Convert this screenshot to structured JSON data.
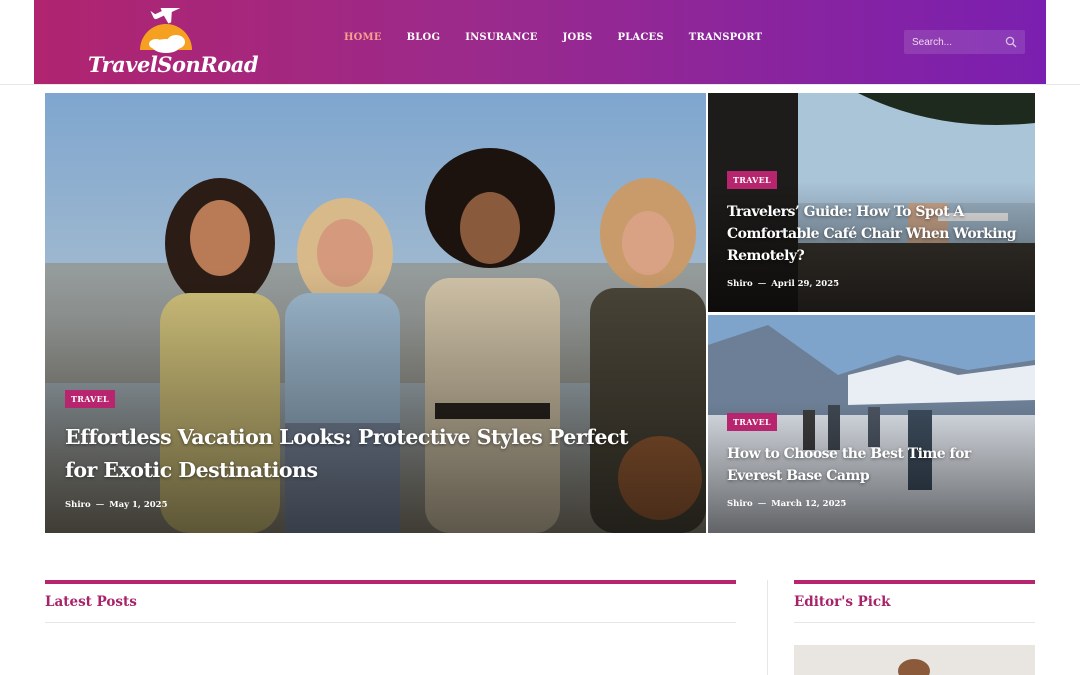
{
  "brand": {
    "name": "TravelSonRoad"
  },
  "nav": {
    "items": [
      {
        "label": "HOME",
        "active": true
      },
      {
        "label": "BLOG"
      },
      {
        "label": "INSURANCE"
      },
      {
        "label": "JOBS"
      },
      {
        "label": "PLACES"
      },
      {
        "label": "TRANSPORT"
      }
    ]
  },
  "search": {
    "placeholder": "Search..."
  },
  "hero": {
    "main": {
      "category": "TRAVEL",
      "title": "Effortless Vacation Looks: Protective Styles Perfect for Exotic Destinations",
      "author": "Shiro",
      "separator": "—",
      "date": "May 1, 2025"
    },
    "side_top": {
      "category": "TRAVEL",
      "title": "Travelers’ Guide: How To Spot A Comfortable Café Chair When Working Remotely?",
      "author": "Shiro",
      "separator": "—",
      "date": "April 29, 2025"
    },
    "side_bottom": {
      "category": "TRAVEL",
      "title": "How to Choose the Best Time for Everest Base Camp",
      "author": "Shiro",
      "separator": "—",
      "date": "March 12, 2025"
    }
  },
  "sections": {
    "latest": {
      "title": "Latest Posts"
    },
    "editors": {
      "title": "Editor's Pick"
    }
  },
  "colors": {
    "accent": "#b8256f",
    "header_start": "#b0246f",
    "header_end": "#7a1fb0"
  }
}
